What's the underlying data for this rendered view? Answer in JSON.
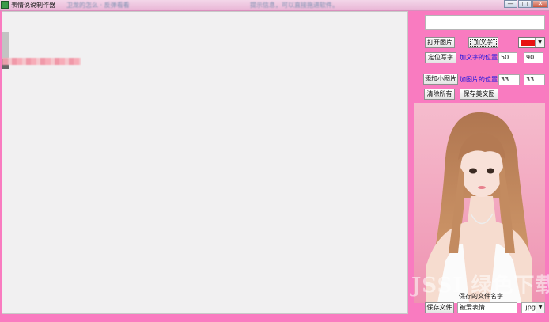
{
  "window": {
    "title": "表情说说制作器",
    "blurred_text": [
      "卫龙的怎么 · 反弹看看",
      "提示信息，可以直接拖进软件。"
    ],
    "controls": [
      "—",
      "□",
      "✕"
    ]
  },
  "toolbar": {
    "open_image_label": "打开图片",
    "add_text_label": "加文字",
    "locate_text_label": "定位写字",
    "text_position_label": "加文字的位置",
    "text_x": "50",
    "text_y": "90",
    "add_small_image_label": "添加小图片",
    "image_position_label": "加图片的位置",
    "image_x": "33",
    "image_y": "33",
    "clear_all_label": "清除所有",
    "save_beauty_label": "保存美文图"
  },
  "color_picker": {
    "value": "#e81010",
    "icon": "chevron-down-icon"
  },
  "preview": {
    "watermark": "JSSI 绿色下载"
  },
  "save": {
    "filename_caption": "保存的文件名字",
    "button_label": "保存文件",
    "filename_value": "被爱表情",
    "format_value": ".jpg"
  },
  "colors": {
    "background": "#f97bc0",
    "canvas": "#f1f0f1",
    "accent_label": "#1010e0"
  }
}
